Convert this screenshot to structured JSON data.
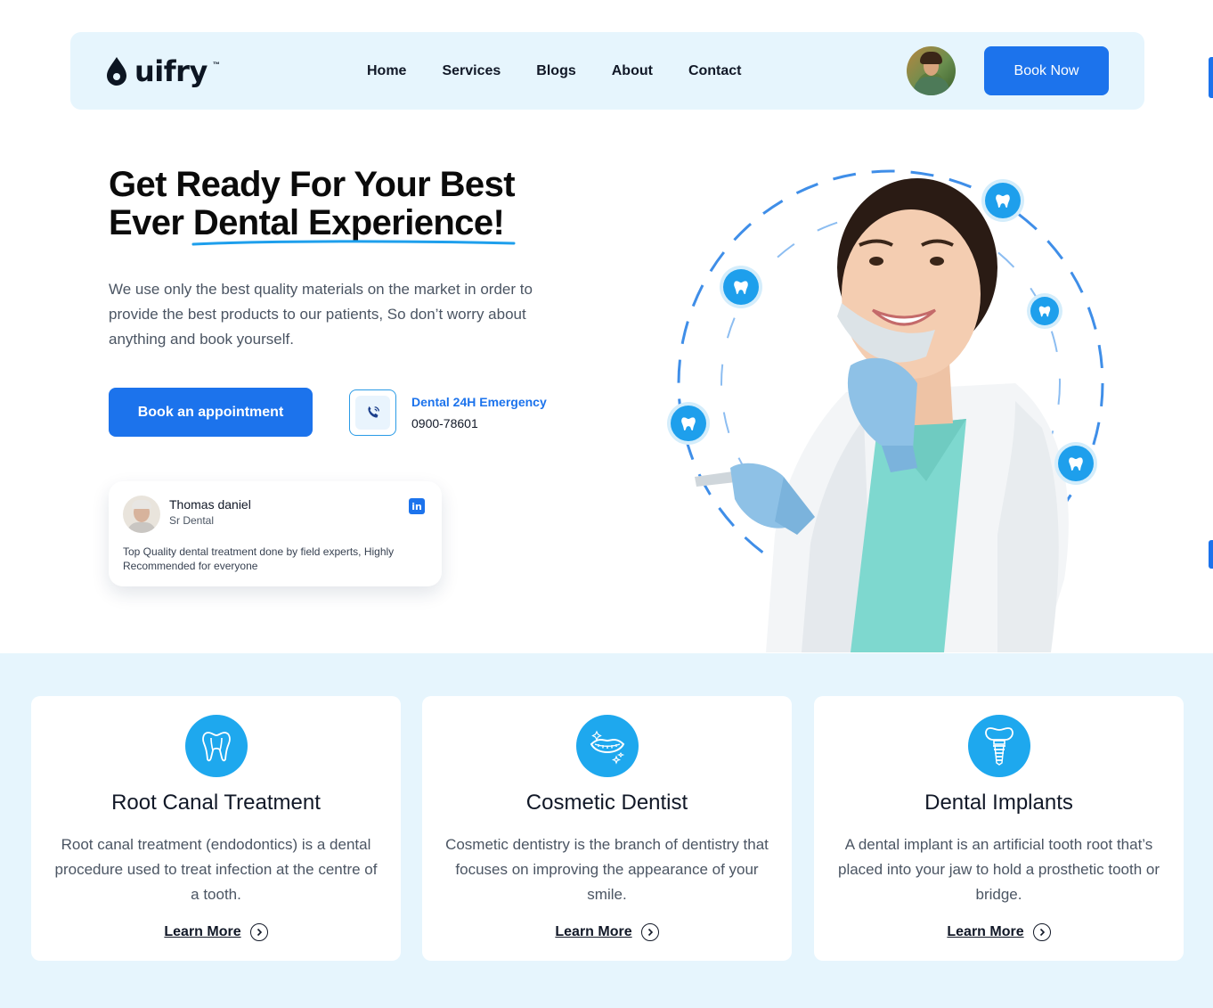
{
  "colors": {
    "primary": "#1c73ec",
    "accent": "#1ea8ee",
    "light_bg": "#e6f5fd"
  },
  "header": {
    "logo_text": "uifry",
    "logo_tm": "™",
    "nav": [
      "Home",
      "Services",
      "Blogs",
      "About",
      "Contact"
    ],
    "cta": "Book Now"
  },
  "hero": {
    "title_line1": "Get Ready For Your Best",
    "title_line2_prefix": "Ever ",
    "title_line2_highlight": "Dental Experience!",
    "description": "We use only the best quality materials on the market in order to provide the best products to our patients, So don’t worry about anything and book yourself.",
    "primary_button": "Book an appointment",
    "emergency": {
      "icon": "phone-call-icon",
      "label": "Dental 24H Emergency",
      "phone": "0900-78601"
    }
  },
  "testimonial": {
    "name": "Thomas daniel",
    "role": "Sr Dental",
    "social": "in",
    "text": "Top Quality dental treatment done by field experts, Highly Recommended for everyone"
  },
  "services": [
    {
      "icon": "tooth-root-icon",
      "title": "Root Canal Treatment",
      "description": "Root canal treatment (endodontics) is a dental procedure used to treat infection at the centre of a tooth.",
      "link": "Learn More"
    },
    {
      "icon": "smile-icon",
      "title": "Cosmetic Dentist",
      "description": "Cosmetic dentistry is the branch of dentistry that focuses on improving the appearance of your smile.",
      "link": "Learn More"
    },
    {
      "icon": "dental-implant-icon",
      "title": "Dental Implants",
      "description": "A dental implant is an artificial tooth root that’s placed into your jaw to hold a prosthetic tooth or bridge.",
      "link": "Learn More"
    }
  ]
}
